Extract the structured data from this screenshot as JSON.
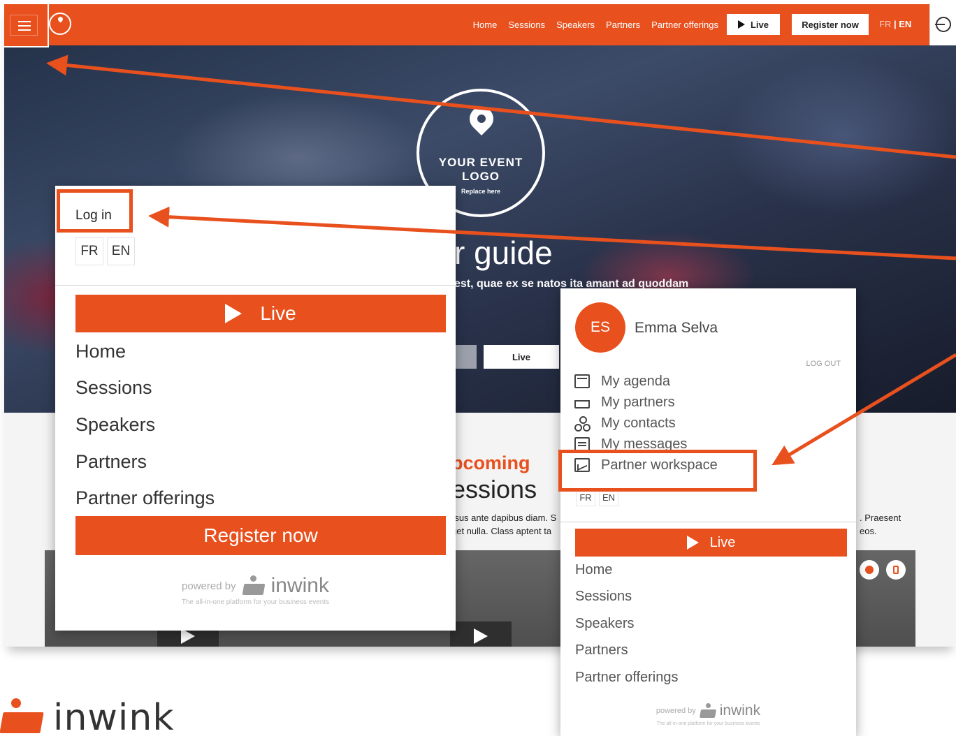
{
  "topbar": {
    "nav": [
      "Home",
      "Sessions",
      "Speakers",
      "Partners",
      "Partner offerings"
    ],
    "live_label": "Live",
    "register_label": "Register now",
    "lang_fr": "FR",
    "lang_sep": " | ",
    "lang_en": "EN"
  },
  "hero": {
    "logo_line1": "YOUR EVENT",
    "logo_line2": "LOGO",
    "logo_line3": "Replace here",
    "title": "r guide",
    "subtitle": "est, quae ex se natos ita amant ad quoddam",
    "live_label": "Live"
  },
  "content": {
    "upcoming_line1": "pcoming",
    "upcoming_line2": "essions",
    "desc1": "rsus ante dapibus diam. S",
    "desc2": "get nulla. Class aptent ta",
    "desc3": ". Praesent",
    "desc4": "eos."
  },
  "menu_left": {
    "login": "Log in",
    "lang_fr": "FR",
    "lang_en": "EN",
    "live_label": "Live",
    "items": [
      "Home",
      "Sessions",
      "Speakers",
      "Partners",
      "Partner offerings"
    ],
    "register_label": "Register now",
    "powered_by": "powered by",
    "brand": "inwink",
    "tagline": "The all-in-one platform for your business events"
  },
  "menu_right": {
    "initials": "ES",
    "user_name": "Emma Selva",
    "logout": "LOG OUT",
    "items": [
      "My agenda",
      "My partners",
      "My contacts",
      "My messages",
      "Partner workspace"
    ],
    "lang_fr": "FR",
    "lang_en": "EN",
    "live_label": "Live",
    "nav": [
      "Home",
      "Sessions",
      "Speakers",
      "Partners",
      "Partner offerings"
    ],
    "powered_by": "powered by",
    "brand": "inwink",
    "tagline": "The all-in-one platform for your business events"
  },
  "footer_brand": "inwink",
  "colors": {
    "accent": "#e8501e",
    "panel_bg": "#ffffff",
    "hero_dark": "#24324a"
  },
  "icons": [
    "menu-icon",
    "location-pin-icon",
    "play-icon",
    "login-icon",
    "calendar-icon",
    "partners-icon",
    "contacts-icon",
    "messages-icon",
    "chart-icon",
    "star-icon",
    "bookmark-icon"
  ]
}
